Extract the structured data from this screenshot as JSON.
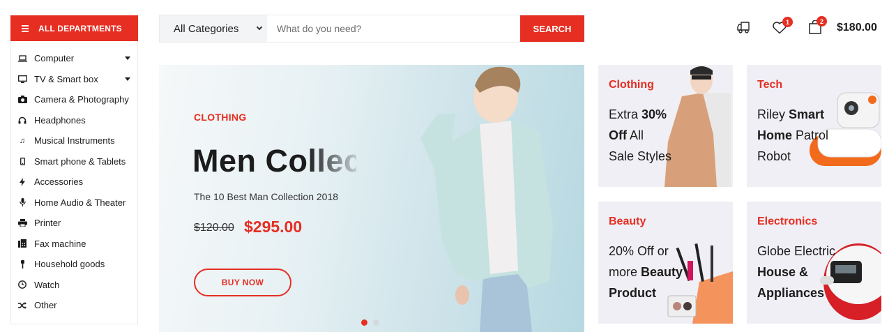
{
  "departments": {
    "button_label": "ALL DEPARTMENTS",
    "items": [
      {
        "label": "Computer",
        "icon": "laptop-icon",
        "has_submenu": true
      },
      {
        "label": "TV & Smart box",
        "icon": "tv-icon",
        "has_submenu": true
      },
      {
        "label": "Camera & Photography",
        "icon": "camera-icon",
        "has_submenu": false
      },
      {
        "label": "Headphones",
        "icon": "headphones-icon",
        "has_submenu": false
      },
      {
        "label": "Musical Instruments",
        "icon": "music-icon",
        "has_submenu": false
      },
      {
        "label": "Smart phone & Tablets",
        "icon": "smartphone-icon",
        "has_submenu": false
      },
      {
        "label": "Accessories",
        "icon": "bolt-icon",
        "has_submenu": false
      },
      {
        "label": "Home Audio & Theater",
        "icon": "microphone-icon",
        "has_submenu": false
      },
      {
        "label": "Printer",
        "icon": "printer-icon",
        "has_submenu": false
      },
      {
        "label": "Fax machine",
        "icon": "fax-icon",
        "has_submenu": false
      },
      {
        "label": "Household goods",
        "icon": "brush-icon",
        "has_submenu": false
      },
      {
        "label": "Watch",
        "icon": "clock-icon",
        "has_submenu": false
      },
      {
        "label": "Other",
        "icon": "shuffle-icon",
        "has_submenu": false
      }
    ]
  },
  "search": {
    "category_selected": "All Categories",
    "placeholder": "What do you need?",
    "button_label": "SEARCH"
  },
  "header": {
    "wishlist_count": "1",
    "cart_count": "2",
    "cart_total": "$180.00"
  },
  "hero": {
    "category": "CLOTHING",
    "title": "Men Collection",
    "subtitle": "The 10 Best Man Collection 2018",
    "old_price": "$120.00",
    "new_price": "$295.00",
    "button_label": "BUY NOW",
    "slides": 2,
    "active_slide": 1
  },
  "promos": [
    {
      "category": "Clothing",
      "line1_pre": "Extra ",
      "line1_bold": "30%",
      "line2_bold": "Off",
      "line2_post": " All",
      "line3": "Sale Styles"
    },
    {
      "category": "Tech",
      "line1_pre": "Riley ",
      "line1_bold": "Smart",
      "line2_bold": "Home",
      "line2_post": " Patrol",
      "line3": "Robot"
    },
    {
      "category": "Beauty",
      "line1_pre": "20% Off or",
      "line1_bold": "",
      "line2_bold": "",
      "line2_post": "more ",
      "line2_bold_end": "Beauty",
      "line3_bold": "Product"
    },
    {
      "category": "Electronics",
      "line1_pre": "Globe Electric",
      "line1_bold": "",
      "line2_bold": "House &",
      "line2_post": "",
      "line3_bold": "Appliances"
    }
  ],
  "colors": {
    "accent": "#e62e22",
    "text": "#1c1c1c",
    "card_bg": "#efeff5"
  }
}
